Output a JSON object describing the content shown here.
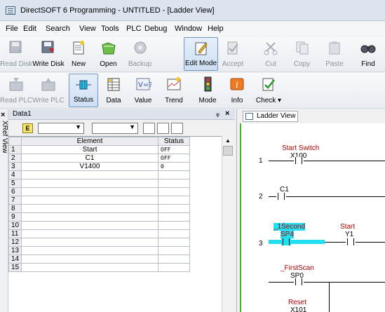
{
  "window": {
    "title": "DirectSOFT 6 Programming - UNTITLED - [Ladder View]"
  },
  "menu": [
    "File",
    "Edit",
    "Search",
    "View",
    "Tools",
    "PLC",
    "Debug",
    "Window",
    "Help"
  ],
  "toolbar1": [
    {
      "label": "Read Disk",
      "icon": "read-disk-icon",
      "enabled": false
    },
    {
      "label": "Write Disk",
      "icon": "write-disk-icon",
      "enabled": true
    },
    {
      "label": "New",
      "icon": "new-icon",
      "enabled": true
    },
    {
      "label": "Open",
      "icon": "open-icon",
      "enabled": true
    },
    {
      "label": "Backup",
      "icon": "backup-icon",
      "enabled": false
    },
    {
      "label": "Edit Mode",
      "icon": "edit-mode-icon",
      "enabled": true,
      "pressed": true
    },
    {
      "label": "Accept",
      "icon": "accept-icon",
      "enabled": false
    },
    {
      "label": "Cut",
      "icon": "cut-icon",
      "enabled": false
    },
    {
      "label": "Copy",
      "icon": "copy-icon",
      "enabled": false
    },
    {
      "label": "Paste",
      "icon": "paste-icon",
      "enabled": false
    },
    {
      "label": "Find",
      "icon": "find-icon",
      "enabled": true
    }
  ],
  "toolbar2": [
    {
      "label": "Read PLC",
      "icon": "read-plc-icon",
      "enabled": false
    },
    {
      "label": "Write PLC",
      "icon": "write-plc-icon",
      "enabled": false
    },
    {
      "label": "Status",
      "icon": "status-icon",
      "enabled": true,
      "pressed": true
    },
    {
      "label": "Data",
      "icon": "data-icon",
      "enabled": true
    },
    {
      "label": "Value",
      "icon": "value-icon",
      "enabled": true
    },
    {
      "label": "Trend",
      "icon": "trend-icon",
      "enabled": true
    },
    {
      "label": "Mode",
      "icon": "mode-icon",
      "enabled": true
    },
    {
      "label": "Info",
      "icon": "info-icon",
      "enabled": true
    },
    {
      "label": "Check",
      "icon": "check-icon",
      "enabled": true,
      "dropdown": "▾"
    }
  ],
  "side_strip": {
    "close": "×",
    "label": "XRef View"
  },
  "data_panel": {
    "title": "Data1",
    "pin": "ᵩ",
    "close": "×",
    "elem_button": "E",
    "columns": [
      "Element",
      "Status"
    ],
    "rows": [
      {
        "n": "1",
        "element": "Start",
        "status": "OFF"
      },
      {
        "n": "2",
        "element": "C1",
        "status": "OFF"
      },
      {
        "n": "3",
        "element": "V1400",
        "status": "0"
      },
      {
        "n": "4",
        "element": "",
        "status": ""
      },
      {
        "n": "5",
        "element": "",
        "status": ""
      },
      {
        "n": "6",
        "element": "",
        "status": ""
      },
      {
        "n": "7",
        "element": "",
        "status": ""
      },
      {
        "n": "8",
        "element": "",
        "status": ""
      },
      {
        "n": "9",
        "element": "",
        "status": ""
      },
      {
        "n": "10",
        "element": "",
        "status": ""
      },
      {
        "n": "11",
        "element": "",
        "status": ""
      },
      {
        "n": "12",
        "element": "",
        "status": ""
      },
      {
        "n": "13",
        "element": "",
        "status": ""
      },
      {
        "n": "14",
        "element": "",
        "status": ""
      },
      {
        "n": "15",
        "element": "",
        "status": ""
      }
    ]
  },
  "ladder": {
    "tab": "Ladder View",
    "rungs": [
      {
        "num": "1",
        "nickname": "Start Switch",
        "address": "X100"
      },
      {
        "num": "2",
        "nickname": "",
        "address": "C1"
      },
      {
        "num": "3",
        "nickname": "_1Second",
        "address": "SP4",
        "nickname2": "Start",
        "address2": "Y1"
      },
      {
        "nickname": "_FirstScan",
        "address": "SP0"
      },
      {
        "nickname": "Reset",
        "address": "X101"
      }
    ]
  },
  "colors": {
    "highlight": "#23e0f0",
    "rail": "#4caf2b",
    "nickname": "#b00000"
  }
}
